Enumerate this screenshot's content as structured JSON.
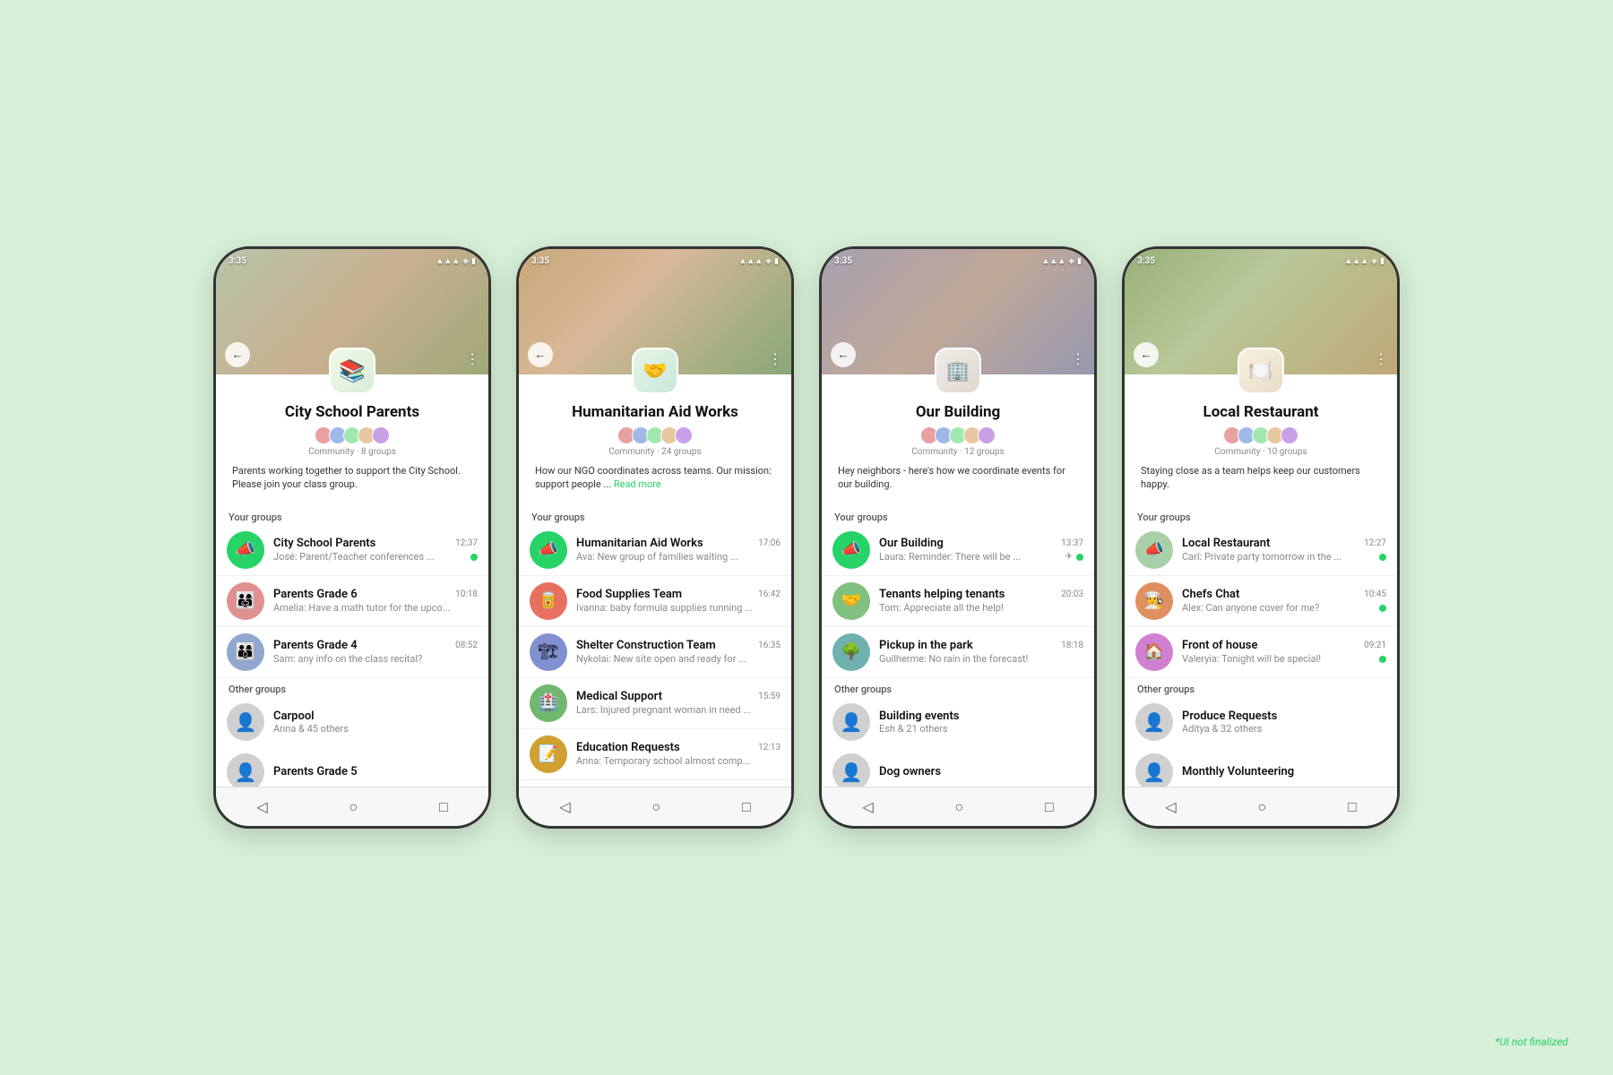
{
  "background": "#d8f0d8",
  "disclaimer": "*UI not finalized",
  "phones": [
    {
      "id": "phone-1",
      "status_time": "3:35",
      "bg_class": "bg-school",
      "logo_class": "logo-school",
      "logo_icon": "📚",
      "community_name": "City School Parents",
      "community_meta": "Community · 8 groups",
      "description": "Parents working together to support the City School. Please join your class group.",
      "your_groups_label": "Your groups",
      "your_groups": [
        {
          "name": "City School Parents",
          "time": "12:37",
          "preview": "José: Parent/Teacher conferences ...",
          "avatar_type": "announcement",
          "icon": "📣",
          "dot": true
        },
        {
          "name": "Parents Grade 6",
          "time": "10:18",
          "preview": "Amelia: Have a math tutor for the upco...",
          "avatar_type": "parents6",
          "icon": "👨‍👩‍👧",
          "dot": false
        },
        {
          "name": "Parents Grade 4",
          "time": "08:52",
          "preview": "Sam: any info on the class recital?",
          "avatar_type": "parents4",
          "icon": "👨‍👩‍👦",
          "dot": false
        }
      ],
      "other_groups_label": "Other groups",
      "other_groups": [
        {
          "name": "Carpool",
          "sub": "Anna & 45 others"
        },
        {
          "name": "Parents Grade 5",
          "sub": ""
        }
      ]
    },
    {
      "id": "phone-2",
      "status_time": "3:35",
      "bg_class": "bg-aid",
      "logo_class": "logo-aid",
      "logo_icon": "🤝",
      "community_name": "Humanitarian Aid Works",
      "community_meta": "Community · 24 groups",
      "description": "How our NGO coordinates across teams. Our mission: support people ...",
      "read_more": "Read more",
      "your_groups_label": "Your groups",
      "your_groups": [
        {
          "name": "Humanitarian Aid Works",
          "time": "17:06",
          "preview": "Ava: New group of families waiting ...",
          "avatar_type": "announcement",
          "icon": "📣",
          "dot": false
        },
        {
          "name": "Food Supplies Team",
          "time": "16:42",
          "preview": "Ivanna: baby formula supplies running ...",
          "avatar_type": "food",
          "icon": "🥫",
          "dot": false
        },
        {
          "name": "Shelter Construction Team",
          "time": "16:35",
          "preview": "Nykolai: New site open and ready for ...",
          "avatar_type": "shelter",
          "icon": "🏗️",
          "dot": false
        },
        {
          "name": "Medical Support",
          "time": "15:59",
          "preview": "Lars: Injured pregnant woman in need ...",
          "avatar_type": "medical",
          "icon": "🏥",
          "dot": false
        },
        {
          "name": "Education Requests",
          "time": "12:13",
          "preview": "Anna: Temporary school almost comp...",
          "avatar_type": "education",
          "icon": "📝",
          "dot": false
        }
      ],
      "other_groups_label": "",
      "other_groups": []
    },
    {
      "id": "phone-3",
      "status_time": "3:35",
      "bg_class": "bg-building",
      "logo_class": "logo-building",
      "logo_icon": "🏢",
      "community_name": "Our Building",
      "community_meta": "Community · 12 groups",
      "description": "Hey neighbors - here's how we coordinate events for our building.",
      "your_groups_label": "Your groups",
      "your_groups": [
        {
          "name": "Our Building",
          "time": "13:37",
          "preview": "Laura: Reminder:  There will be ...",
          "avatar_type": "announcement",
          "icon": "📣",
          "pin": true,
          "dot": true
        },
        {
          "name": "Tenants helping tenants",
          "time": "20:03",
          "preview": "Tom: Appreciate all the help!",
          "avatar_type": "tenants",
          "icon": "🤝",
          "dot": false
        },
        {
          "name": "Pickup in the park",
          "time": "18:18",
          "preview": "Guilherme: No rain in the forecast!",
          "avatar_type": "park",
          "icon": "🌳",
          "dot": false
        }
      ],
      "other_groups_label": "Other groups",
      "other_groups": [
        {
          "name": "Building events",
          "sub": "Esh & 21 others"
        },
        {
          "name": "Dog owners",
          "sub": ""
        }
      ]
    },
    {
      "id": "phone-4",
      "status_time": "3:35",
      "bg_class": "bg-restaurant",
      "logo_class": "logo-restaurant",
      "logo_icon": "🍽️",
      "community_name": "Local Restaurant",
      "community_meta": "Community · 10 groups",
      "description": "Staying close as a team helps keep our customers happy.",
      "your_groups_label": "Your groups",
      "your_groups": [
        {
          "name": "Local Restaurant",
          "time": "12:27",
          "preview": "Carl: Private party tomorrow in the ...",
          "avatar_type": "restaurant-logo",
          "icon": "📣",
          "dot": true
        },
        {
          "name": "Chefs Chat",
          "time": "10:45",
          "preview": "Alex: Can anyone cover for me?",
          "avatar_type": "chefs",
          "icon": "👨‍🍳",
          "dot": true
        },
        {
          "name": "Front of house",
          "time": "09:21",
          "preview": "Valeryia: Tonight will be special!",
          "avatar_type": "front",
          "icon": "🏠",
          "dot": true
        }
      ],
      "other_groups_label": "Other groups",
      "other_groups": [
        {
          "name": "Produce Requests",
          "sub": "Aditya & 32 others"
        },
        {
          "name": "Monthly Volunteering",
          "sub": ""
        }
      ]
    }
  ]
}
